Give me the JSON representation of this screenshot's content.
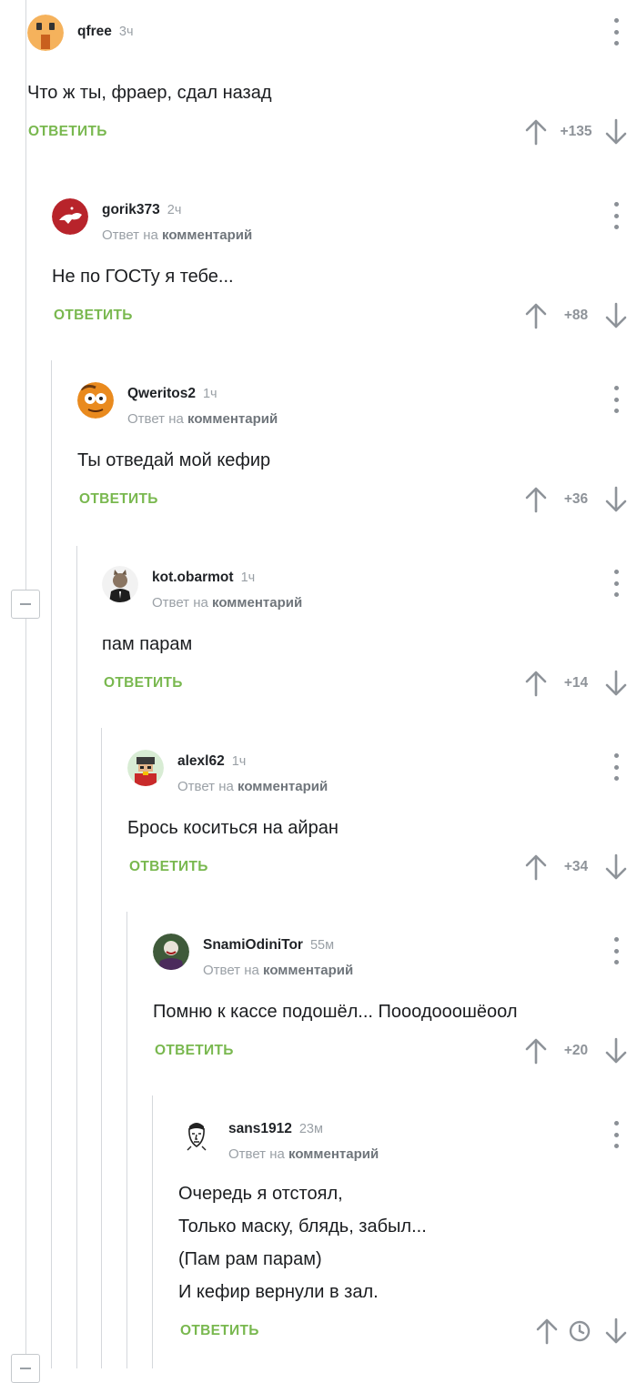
{
  "comments": [
    {
      "username": "qfree",
      "time": "3ч",
      "text": "Что ж ты, фраер, сдал назад",
      "reply_label": "ОТВЕТИТЬ",
      "rating": "+135",
      "avatar": "avatar-orange-icon"
    },
    {
      "username": "gorik373",
      "time": "2ч",
      "reply_prefix": "Ответ на",
      "reply_link": "комментарий",
      "text": "Не по ГОСТу я тебе...",
      "reply_label": "ОТВЕТИТЬ",
      "rating": "+88",
      "avatar": "avatar-red-lion-icon"
    },
    {
      "username": "Qweritos2",
      "time": "1ч",
      "reply_prefix": "Ответ на",
      "reply_link": "комментарий",
      "text": "Ты отведай мой кефир",
      "reply_label": "ОТВЕТИТЬ",
      "rating": "+36",
      "avatar": "avatar-cartoon-icon"
    },
    {
      "username": "kot.obarmot",
      "time": "1ч",
      "reply_prefix": "Ответ на",
      "reply_link": "комментарий",
      "text": "пам парам",
      "reply_label": "ОТВЕТИТЬ",
      "rating": "+14",
      "avatar": "avatar-cat-suit-icon"
    },
    {
      "username": "alexl62",
      "time": "1ч",
      "reply_prefix": "Ответ на",
      "reply_link": "комментарий",
      "text": "Брось коситься на айран",
      "reply_label": "ОТВЕТИТЬ",
      "rating": "+34",
      "avatar": "avatar-pixel-icon"
    },
    {
      "username": "SnamiOdiniTor",
      "time": "55м",
      "reply_prefix": "Ответ на",
      "reply_link": "комментарий",
      "text": "Помню к кассе подошёл... Пооодооошёоол",
      "reply_label": "ОТВЕТИТЬ",
      "rating": "+20",
      "avatar": "avatar-joker-icon"
    },
    {
      "username": "sans1912",
      "time": "23м",
      "reply_prefix": "Ответ на",
      "reply_link": "комментарий",
      "text_lines": [
        "Очередь я отстоял,",
        "Только маску, блядь, забыл...",
        "(Пам рам парам)",
        "И кефир вернули в зал."
      ],
      "reply_label": "ОТВЕТИТЬ",
      "rating_icon": "clock-icon",
      "avatar": "avatar-sketch-face-icon"
    }
  ],
  "icons": {
    "upvote": "arrow-up-icon",
    "downvote": "arrow-down-icon",
    "menu": "more-vertical-icon",
    "collapse": "collapse-minus-icon"
  },
  "colors": {
    "reply": "#79b84f",
    "thread_line": "#d5d8dc",
    "muted": "#9aa0a6"
  }
}
